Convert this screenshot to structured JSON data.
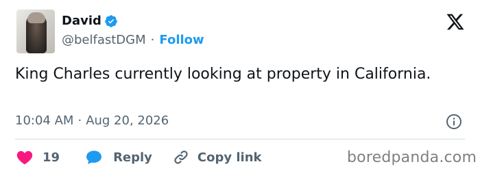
{
  "author": {
    "display_name": "David",
    "handle": "@belfastDGM",
    "separator": "·",
    "follow_label": "Follow"
  },
  "tweet": {
    "text": "King Charles currently looking at property in California.",
    "time": "10:04 AM",
    "separator": "·",
    "date": "Aug 20, 2026"
  },
  "actions": {
    "like_count": "19",
    "reply_label": "Reply",
    "copy_link_label": "Copy link"
  },
  "watermark": "boredpanda.com",
  "colors": {
    "accent": "#1d9bf0",
    "like": "#f91880",
    "text_secondary": "#536471"
  },
  "icons": [
    "verified-badge-icon",
    "x-logo-icon",
    "info-icon",
    "heart-icon",
    "reply-bubble-icon",
    "link-icon"
  ]
}
